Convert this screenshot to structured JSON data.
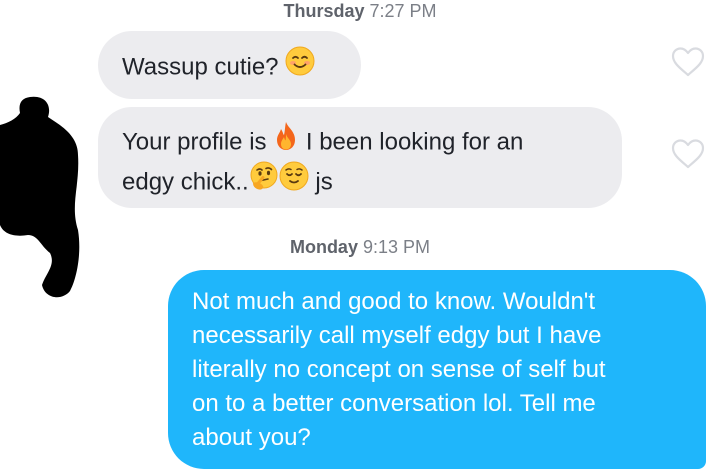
{
  "timestamps": [
    {
      "day": "Thursday",
      "time": "7:27 PM"
    },
    {
      "day": "Monday",
      "time": "9:13 PM"
    }
  ],
  "messages": [
    {
      "direction": "incoming",
      "text_parts": [
        "Wassup cutie? "
      ],
      "emojis": [
        "smiling-face-icon"
      ],
      "liked": false
    },
    {
      "direction": "incoming",
      "line1": "Your profile is",
      "line1_after": "I been looking for an",
      "line2": "edgy chick..",
      "line2_after": "js",
      "emojis": [
        "fire-icon",
        "thinking-face-icon",
        "relieved-face-icon"
      ],
      "liked": false
    },
    {
      "direction": "outgoing",
      "lines": [
        "Not much and good to know. Wouldn't",
        "necessarily call myself edgy but I have",
        "literally no concept on sense of self but",
        "on to a better conversation lol. Tell me",
        "about you?"
      ]
    }
  ],
  "colors": {
    "incoming_bubble": "#ececef",
    "outgoing_bubble": "#1fb6fb",
    "timestamp_text": "#7b7f87",
    "heart_outline": "#d9dbe0"
  }
}
